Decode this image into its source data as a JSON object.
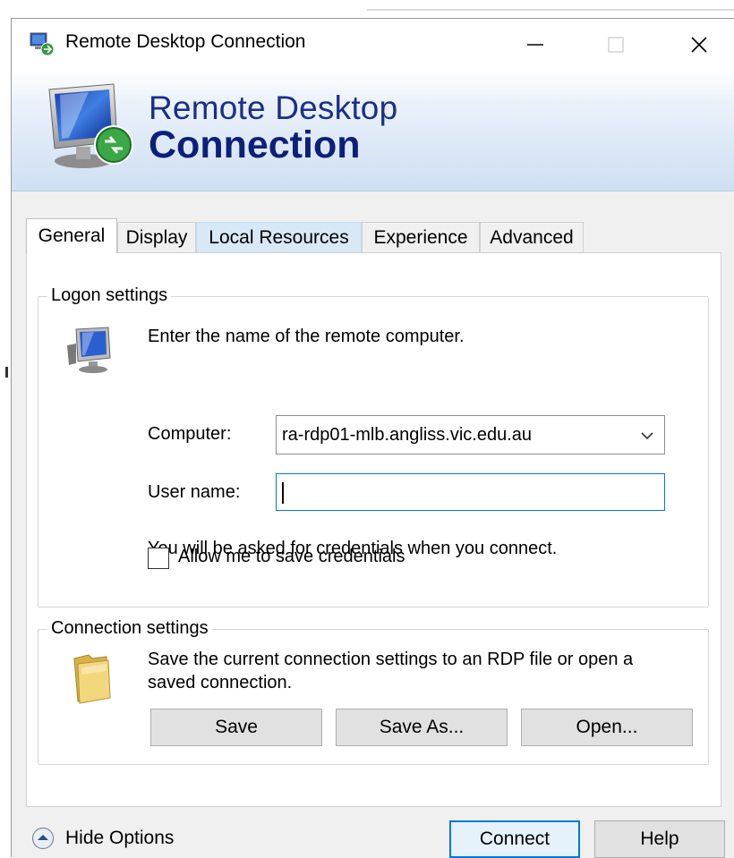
{
  "window": {
    "title": "Remote Desktop Connection",
    "controls": {
      "minimize": "minimize",
      "maximize": "maximize",
      "close": "close"
    }
  },
  "banner": {
    "line1": "Remote Desktop",
    "line2": "Connection"
  },
  "tabs": [
    {
      "label": "General",
      "active": true
    },
    {
      "label": "Display",
      "active": false
    },
    {
      "label": "Local Resources",
      "active": false
    },
    {
      "label": "Experience",
      "active": false
    },
    {
      "label": "Advanced",
      "active": false
    }
  ],
  "logon": {
    "title": "Logon settings",
    "intro": "Enter the name of the remote computer.",
    "computer_label": "Computer:",
    "computer_value": "ra-rdp01-mlb.angliss.vic.edu.au",
    "username_label": "User name:",
    "username_value": "",
    "credentials_note": "You will be asked for credentials when you connect.",
    "save_credentials_label": "Allow me to save credentials",
    "save_credentials_checked": false
  },
  "connection": {
    "title": "Connection settings",
    "description_line1": "Save the current connection settings to an RDP file or open a",
    "description_line2": "saved connection.",
    "save_label": "Save",
    "save_as_label": "Save As...",
    "open_label": "Open..."
  },
  "footer": {
    "hide_options_label": "Hide Options",
    "connect_label": "Connect",
    "help_label": "Help"
  },
  "colors": {
    "accent": "#0078d7",
    "banner_text": "#0c1f7a",
    "panel_bg": "#f0f0f0"
  }
}
